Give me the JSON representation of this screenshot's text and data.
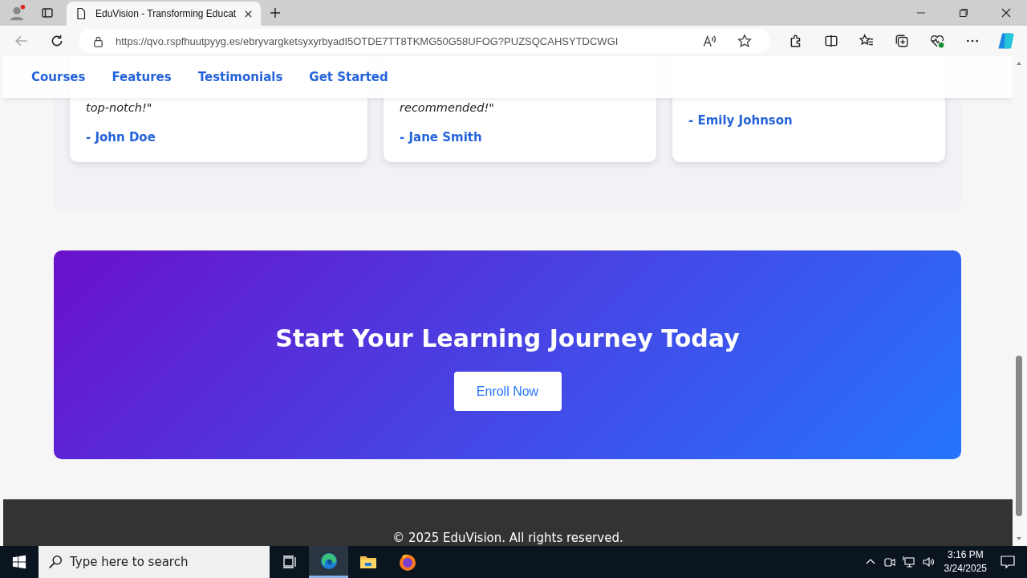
{
  "browser": {
    "tab": {
      "title": "EduVision - Transforming Educat",
      "selected": true
    },
    "address": "https://qvo.rspfhuutpyyg.es/ebryvargketsyxyrbyadI5OTDE7TT8TKMG50G58UFOG?PUZSQCAHSYTDCWGI"
  },
  "nav": {
    "links": [
      "Courses",
      "Features",
      "Testimonials",
      "Get Started"
    ]
  },
  "testimonials": [
    {
      "quote": "top-notch!\"",
      "author": "- John Doe"
    },
    {
      "quote": "recommended!\"",
      "author": "- Jane Smith"
    },
    {
      "author": "- Emily Johnson"
    }
  ],
  "cta": {
    "title": "Start Your Learning Journey Today",
    "button": "Enroll Now"
  },
  "footer": {
    "text": "© 2025 EduVision. All rights reserved."
  },
  "taskbar": {
    "search_placeholder": "Type here to search",
    "apps": [
      {
        "kind": "edge",
        "selected": true
      },
      {
        "kind": "explorer",
        "selected": false
      },
      {
        "kind": "firefox",
        "selected": false
      }
    ],
    "time": "3:16 PM",
    "date": "3/24/2025"
  }
}
